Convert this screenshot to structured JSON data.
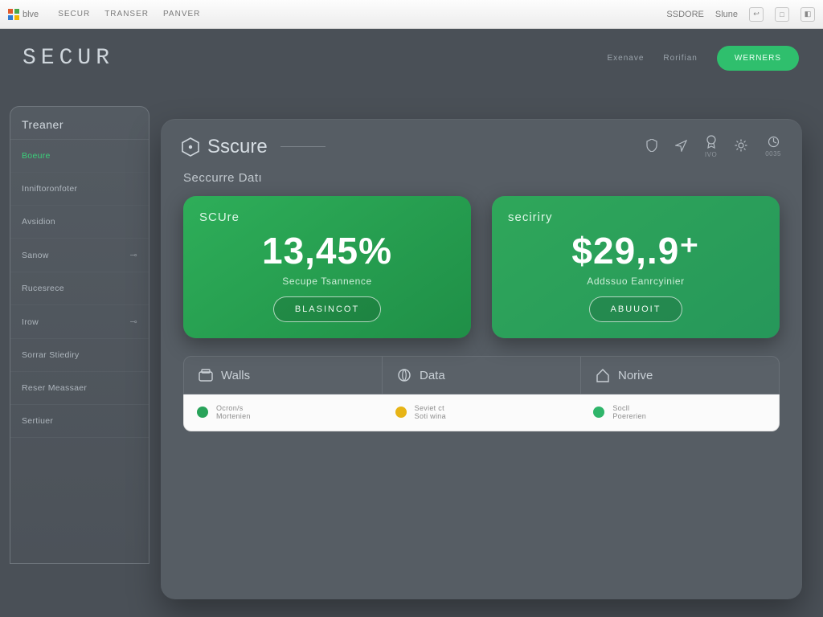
{
  "chrome": {
    "brand": "blve",
    "tabs": [
      "SECUR",
      "Transer",
      "Panver"
    ],
    "right_label": "SSDORE",
    "right_label2": "Slune"
  },
  "header": {
    "wordmark": "SECUR",
    "nav1": "Exenave",
    "nav2": "Rorifian",
    "cta": "WERNERS"
  },
  "sidebar": {
    "title": "Treaner",
    "items": [
      {
        "label": "Boeure",
        "active": true
      },
      {
        "label": "Inniftoronfoter"
      },
      {
        "label": "Avsidion"
      },
      {
        "label": "Sanow",
        "chev": true
      },
      {
        "label": "Rucesrece"
      },
      {
        "label": "Irow",
        "chev": true
      },
      {
        "label": "Sorrar Stiediry"
      },
      {
        "label": "Reser Meassaer"
      },
      {
        "label": "Sertiuer"
      }
    ]
  },
  "panel": {
    "brand": "Sscure",
    "icons": [
      {
        "name": "shield-icon",
        "label": ""
      },
      {
        "name": "send-icon",
        "label": ""
      },
      {
        "name": "badge-icon",
        "label": "IVO"
      },
      {
        "name": "gear-icon",
        "label": ""
      },
      {
        "name": "stat-icon",
        "label": "0035"
      }
    ],
    "subtitle": "Seccurre Datı"
  },
  "cards": [
    {
      "title": "SCUre",
      "value": "13,45%",
      "caption": "Secupe Tsannence",
      "button": "BLASINCOT"
    },
    {
      "title": "seciriry",
      "value": "$29,.9⁺",
      "caption": "Addssuo Eanrcyinier",
      "button": "ABUUOIT"
    }
  ],
  "tiles": [
    {
      "icon": "wallet-icon",
      "label": "Walls"
    },
    {
      "icon": "data-icon",
      "label": "Data"
    },
    {
      "icon": "home-icon",
      "label": "Norive"
    }
  ],
  "status": [
    {
      "color": "g",
      "line1": "Ocron/s",
      "line2": "Mortenien"
    },
    {
      "color": "y",
      "line1": "Seviet ct",
      "line2": "Soti wina"
    },
    {
      "color": "g2",
      "line1": "Socll",
      "line2": "Poererien"
    }
  ]
}
